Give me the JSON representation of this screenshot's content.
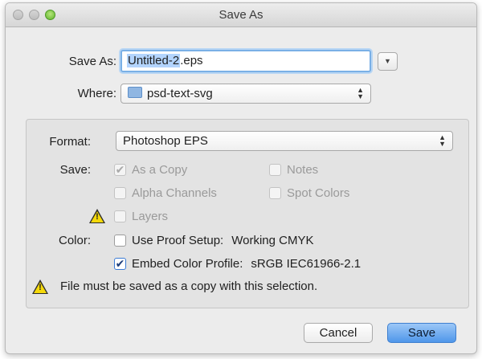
{
  "window": {
    "title": "Save As"
  },
  "save_as": {
    "label": "Save As:",
    "filename_selected": "Untitled-2",
    "filename_ext": ".eps"
  },
  "where": {
    "label": "Where:",
    "value": "psd-text-svg"
  },
  "format": {
    "label": "Format:",
    "value": "Photoshop EPS"
  },
  "save_options": {
    "label": "Save:",
    "as_a_copy": {
      "label": "As a Copy",
      "checked": true,
      "enabled": false
    },
    "notes": {
      "label": "Notes",
      "checked": false,
      "enabled": false
    },
    "alpha_channels": {
      "label": "Alpha Channels",
      "checked": false,
      "enabled": false
    },
    "spot_colors": {
      "label": "Spot Colors",
      "checked": false,
      "enabled": false
    },
    "layers": {
      "label": "Layers",
      "checked": false,
      "enabled": false
    }
  },
  "color": {
    "label": "Color:",
    "use_proof_setup": {
      "label": "Use Proof Setup:",
      "value": "Working CMYK",
      "checked": false
    },
    "embed_color_profile": {
      "label": "Embed Color Profile:",
      "value": "sRGB IEC61966-2.1",
      "checked": true
    }
  },
  "warning": {
    "message": "File must be saved as a copy with this selection."
  },
  "buttons": {
    "cancel": "Cancel",
    "save": "Save"
  },
  "check_glyph": "✔"
}
